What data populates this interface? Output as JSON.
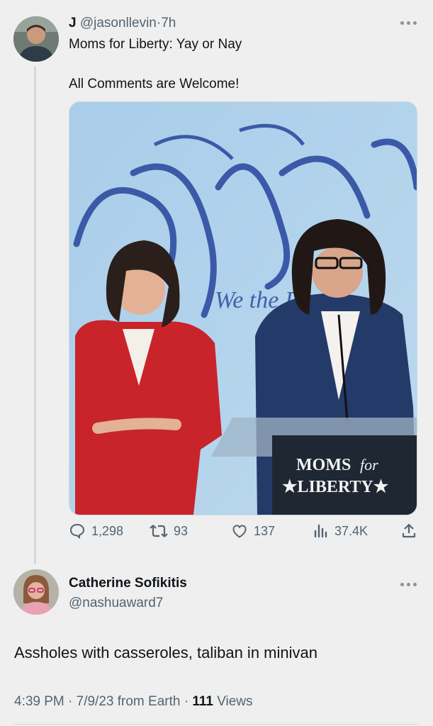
{
  "tweet": {
    "display_name": "J",
    "handle": "@jasonllevin",
    "separator": "·",
    "time": "7h",
    "text_line1": "Moms for Liberty: Yay or Nay",
    "text_line2": "All Comments are Welcome!",
    "media": {
      "backdrop_script": "We the People",
      "sign_line1_a": "MOMS",
      "sign_line1_b": "for",
      "sign_line2": "★LIBERTY★"
    },
    "stats": {
      "replies": "1,298",
      "retweets": "93",
      "likes": "137",
      "views": "37.4K"
    }
  },
  "reply": {
    "display_name": "Catherine Sofikitis",
    "handle": "@nashuaward7",
    "text": "Assholes with casseroles, taliban in minivan",
    "meta_time": "4:39 PM · 7/9/23 from Earth · ",
    "views_count": "111",
    "views_label": "Views"
  },
  "icons": [
    "more-icon",
    "reply-icon",
    "retweet-icon",
    "like-icon",
    "views-icon",
    "share-icon"
  ],
  "colors": {
    "background": "#efefef",
    "muted": "#536471",
    "text": "#0f1419"
  }
}
